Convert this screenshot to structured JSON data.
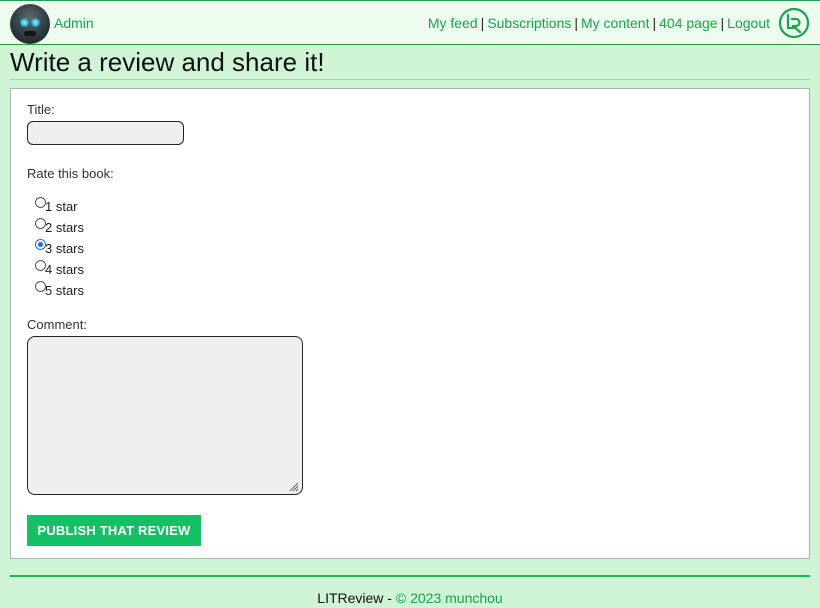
{
  "header": {
    "username": "Admin",
    "nav": [
      {
        "label": "My feed"
      },
      {
        "label": "Subscriptions"
      },
      {
        "label": "My content"
      },
      {
        "label": "404 page"
      },
      {
        "label": "Logout"
      }
    ],
    "separator": "|",
    "logo_icon": "lr-logo-icon",
    "accent_color": "#12a84a"
  },
  "page": {
    "title": "Write a review and share it!"
  },
  "form": {
    "title_label": "Title:",
    "title_value": "",
    "rating_label": "Rate this book:",
    "rating_options": [
      {
        "label": "1 star",
        "checked": false
      },
      {
        "label": "2 stars",
        "checked": false
      },
      {
        "label": "3 stars",
        "checked": true
      },
      {
        "label": "4 stars",
        "checked": false
      },
      {
        "label": "5 stars",
        "checked": false
      }
    ],
    "comment_label": "Comment:",
    "comment_value": "",
    "submit_label": "PUBLISH THAT REVIEW",
    "submit_color": "#12c165"
  },
  "footer": {
    "brand": "LITReview",
    "dash": " - ",
    "copyright": "© 2023 munchou"
  }
}
